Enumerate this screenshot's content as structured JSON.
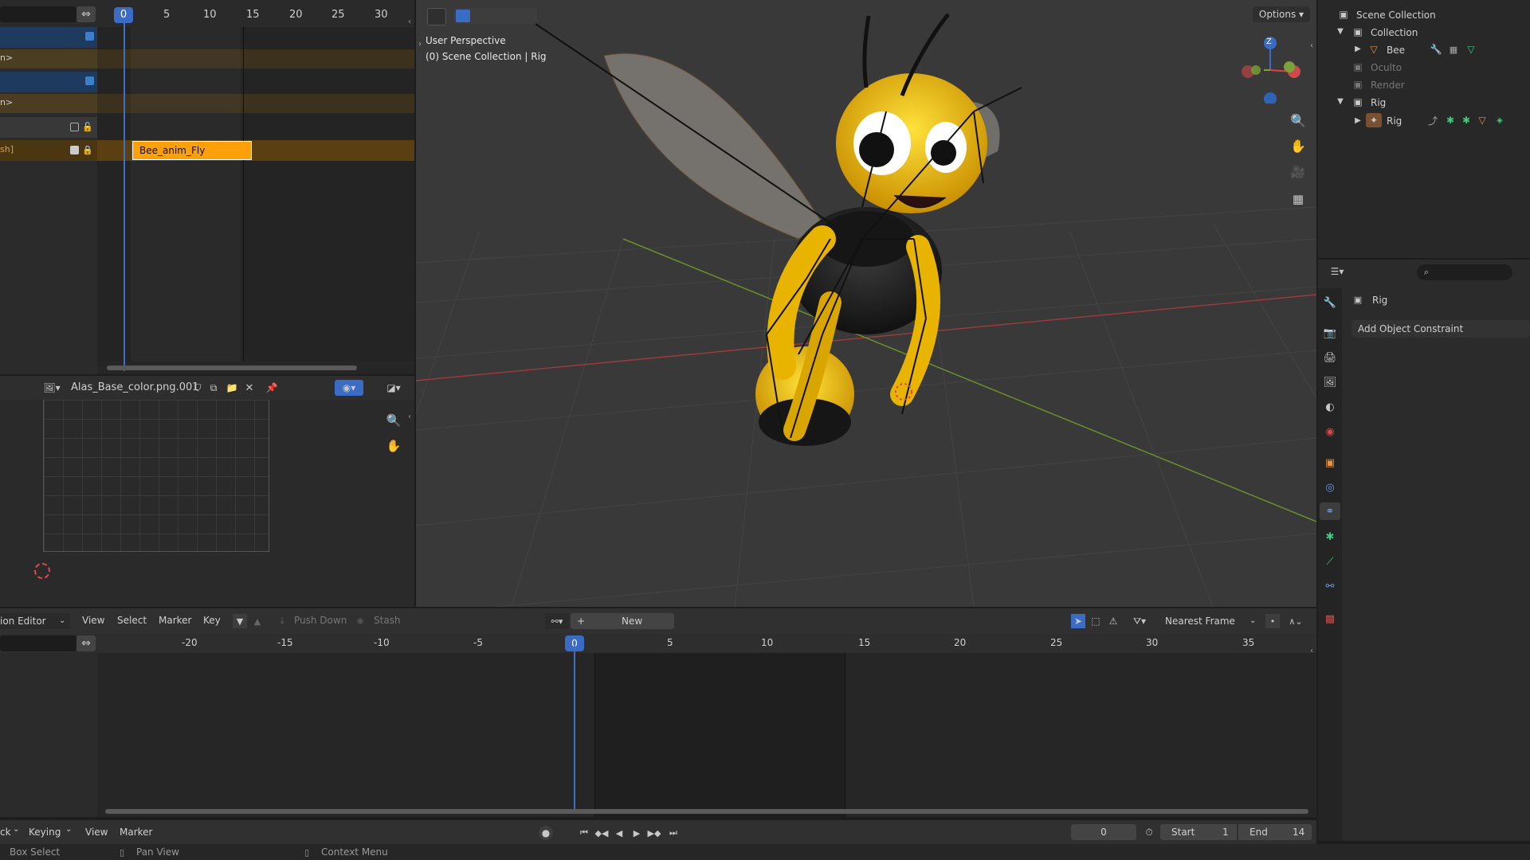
{
  "nla": {
    "timeline_ticks": [
      "0",
      "5",
      "10",
      "15",
      "20",
      "25",
      "30"
    ],
    "current_frame": "0",
    "strip_label": "Bee_anim_Fly",
    "row_labels": [
      "n>",
      "n>",
      "sh]"
    ]
  },
  "image_editor": {
    "image_name": "Alas_Base_color.png.001"
  },
  "viewport": {
    "perspective": "User Perspective",
    "collection": "(0) Scene Collection | Rig",
    "options_label": "Options",
    "gizmo_z": "Z"
  },
  "outliner": {
    "root": "Scene Collection",
    "items": [
      {
        "label": "Collection"
      },
      {
        "label": "Bee"
      },
      {
        "label": "Oculto"
      },
      {
        "label": "Render"
      },
      {
        "label": "Rig"
      },
      {
        "label": "Rig"
      }
    ]
  },
  "properties": {
    "object_name": "Rig",
    "add_constraint_label": "Add Object Constraint",
    "search_placeholder": ""
  },
  "action_editor": {
    "editor_type": "ion Editor",
    "menus": [
      "View",
      "Select",
      "Marker",
      "Key"
    ],
    "push_down": "Push Down",
    "stash": "Stash",
    "new_label": "New",
    "snap_mode": "Nearest Frame",
    "ruler": [
      "-20",
      "-15",
      "-10",
      "-5",
      "0",
      "5",
      "10",
      "15",
      "20",
      "25",
      "30",
      "35"
    ],
    "current_frame": "0"
  },
  "timeline": {
    "menus": [
      "ck",
      "Keying",
      "View",
      "Marker"
    ],
    "current_frame": "0",
    "start_label": "Start",
    "start_value": "1",
    "end_label": "End",
    "end_value": "14"
  },
  "status_bar": {
    "box_select": "Box Select",
    "pan_view": "Pan View",
    "context_menu": "Context Menu"
  }
}
